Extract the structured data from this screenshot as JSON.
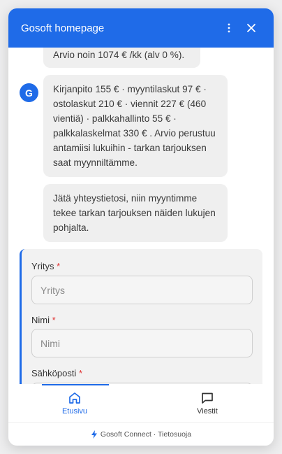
{
  "header": {
    "title": "Gosoft homepage",
    "menu_icon": "more-vertical-icon",
    "close_icon": "close-icon"
  },
  "chat": {
    "avatar_letter": "G",
    "messages": [
      "Arvio noin 1074 € /kk (alv 0 %).",
      "Kirjanpito 155 € · myyntilaskut 97 € · ostolaskut 210 € · viennit 227 € (460 vientiä) · palkkahallinto 55 € · palkkalaskelmat 330 € . Arvio perustuu antamiisi lukuihin - tarkan tarjouksen saat myynniltämme.",
      "Jätä yhteystietosi, niin myyntimme tekee tarkan tarjouksen näiden lukujen pohjalta."
    ]
  },
  "form": {
    "required_mark": "*",
    "fields": [
      {
        "label": "Yritys",
        "placeholder": "Yritys"
      },
      {
        "label": "Nimi",
        "placeholder": "Nimi"
      },
      {
        "label": "Sähköposti",
        "placeholder": ""
      }
    ]
  },
  "nav": {
    "items": [
      {
        "label": "Etusivu",
        "icon": "home-icon",
        "active": true
      },
      {
        "label": "Viestit",
        "icon": "message-icon",
        "active": false
      }
    ]
  },
  "footer": {
    "icon": "lightning-icon",
    "text": "Gosoft Connect · Tietosuoja"
  },
  "colors": {
    "accent": "#1f6be8",
    "required": "#e03131"
  }
}
